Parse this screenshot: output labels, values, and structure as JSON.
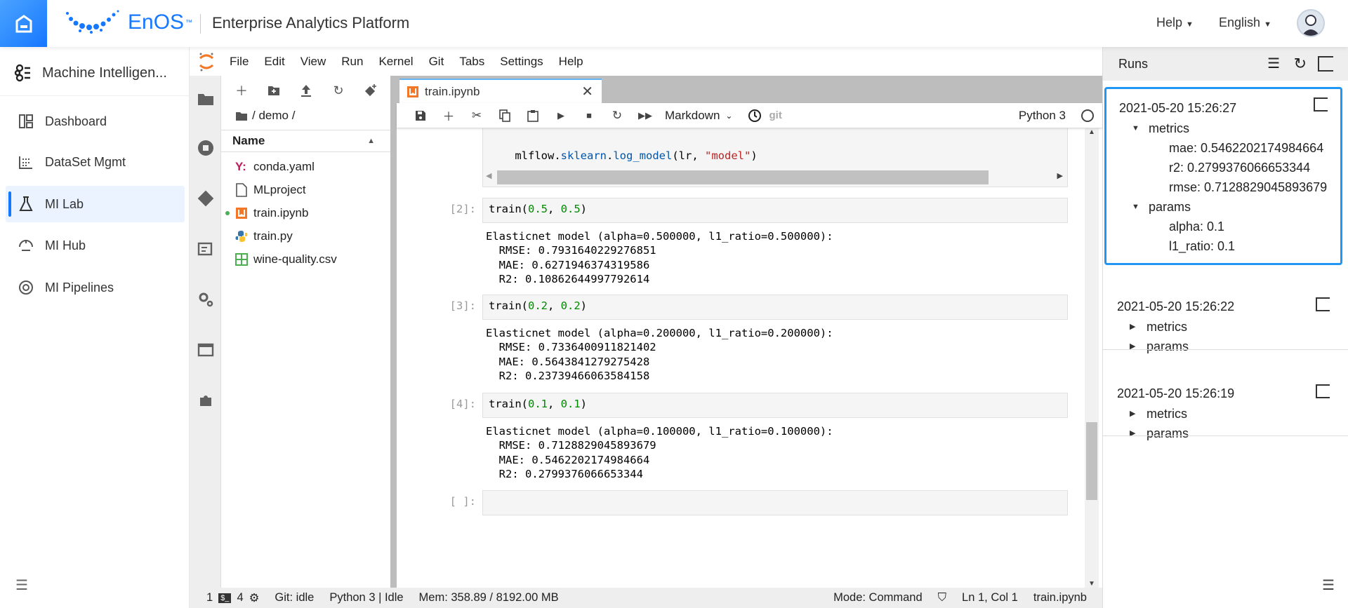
{
  "header": {
    "brand": "EnOS",
    "tm": "™",
    "title": "Enterprise Analytics Platform",
    "help": "Help",
    "language": "English"
  },
  "sidebar": {
    "title": "Machine Intelligen...",
    "items": [
      {
        "label": "Dashboard"
      },
      {
        "label": "DataSet Mgmt"
      },
      {
        "label": "MI Lab",
        "selected": true
      },
      {
        "label": "MI Hub"
      },
      {
        "label": "MI Pipelines"
      }
    ]
  },
  "menu": [
    "File",
    "Edit",
    "View",
    "Run",
    "Kernel",
    "Git",
    "Tabs",
    "Settings",
    "Help"
  ],
  "files": {
    "path": "/ demo /",
    "column": "Name",
    "items": [
      {
        "name": "conda.yaml",
        "icon": "yaml-icon"
      },
      {
        "name": "MLproject",
        "icon": "file-icon"
      },
      {
        "name": "train.ipynb",
        "icon": "notebook-icon",
        "running": true
      },
      {
        "name": "train.py",
        "icon": "python-icon"
      },
      {
        "name": "wine-quality.csv",
        "icon": "spreadsheet-icon"
      }
    ]
  },
  "notebook": {
    "tab": "train.ipynb",
    "cell_type": "Markdown",
    "git": "git",
    "kernel": "Python 3",
    "cell1_line": {
      "a": "    mlflow.",
      "b": "sklearn",
      "c": ".",
      "d": "log_model",
      "e": "(lr, ",
      "f": "\"model\"",
      "g": ")"
    },
    "cells": [
      {
        "prompt": "[2]:",
        "fn": "train(",
        "a1": "0.5",
        "sep": ", ",
        "a2": "0.5",
        "close": ")",
        "output": [
          "Elasticnet model (alpha=0.500000, l1_ratio=0.500000):",
          "  RMSE: 0.7931640229276851",
          "  MAE: 0.6271946374319586",
          "  R2: 0.10862644997792614"
        ]
      },
      {
        "prompt": "[3]:",
        "fn": "train(",
        "a1": "0.2",
        "sep": ", ",
        "a2": "0.2",
        "close": ")",
        "output": [
          "Elasticnet model (alpha=0.200000, l1_ratio=0.200000):",
          "  RMSE: 0.7336400911821402",
          "  MAE: 0.5643841279275428",
          "  R2: 0.23739466063584158"
        ]
      },
      {
        "prompt": "[4]:",
        "fn": "train(",
        "a1": "0.1",
        "sep": ", ",
        "a2": "0.1",
        "close": ")",
        "output": [
          "Elasticnet model (alpha=0.100000, l1_ratio=0.100000):",
          "  RMSE: 0.7128829045893679",
          "  MAE: 0.5462202174984664",
          "  R2: 0.2799376066653344"
        ]
      }
    ],
    "empty_prompt": "[ ]:"
  },
  "status": {
    "terminals": "1",
    "kernels": "4",
    "git": "Git: idle",
    "kernel": "Python 3 | Idle",
    "mem": "Mem: 358.89 / 8192.00 MB",
    "mode": "Mode: Command",
    "position": "Ln 1, Col 1",
    "file": "train.ipynb"
  },
  "runs": {
    "title": "Runs",
    "items": [
      {
        "timestamp": "2021-05-20 15:26:27",
        "expanded": true,
        "metrics_label": "metrics",
        "params_label": "params",
        "metrics": [
          "mae: 0.5462202174984664",
          "r2: 0.2799376066653344",
          "rmse: 0.7128829045893679"
        ],
        "params": [
          "alpha: 0.1",
          "l1_ratio: 0.1"
        ]
      },
      {
        "timestamp": "2021-05-20 15:26:22",
        "metrics_label": "metrics",
        "params_label": "params"
      },
      {
        "timestamp": "2021-05-20 15:26:19",
        "metrics_label": "metrics",
        "params_label": "params"
      }
    ]
  },
  "colors": {
    "accent": "#1677ff",
    "selected_border": "#2196f3",
    "jupyter_orange": "#f37726"
  }
}
